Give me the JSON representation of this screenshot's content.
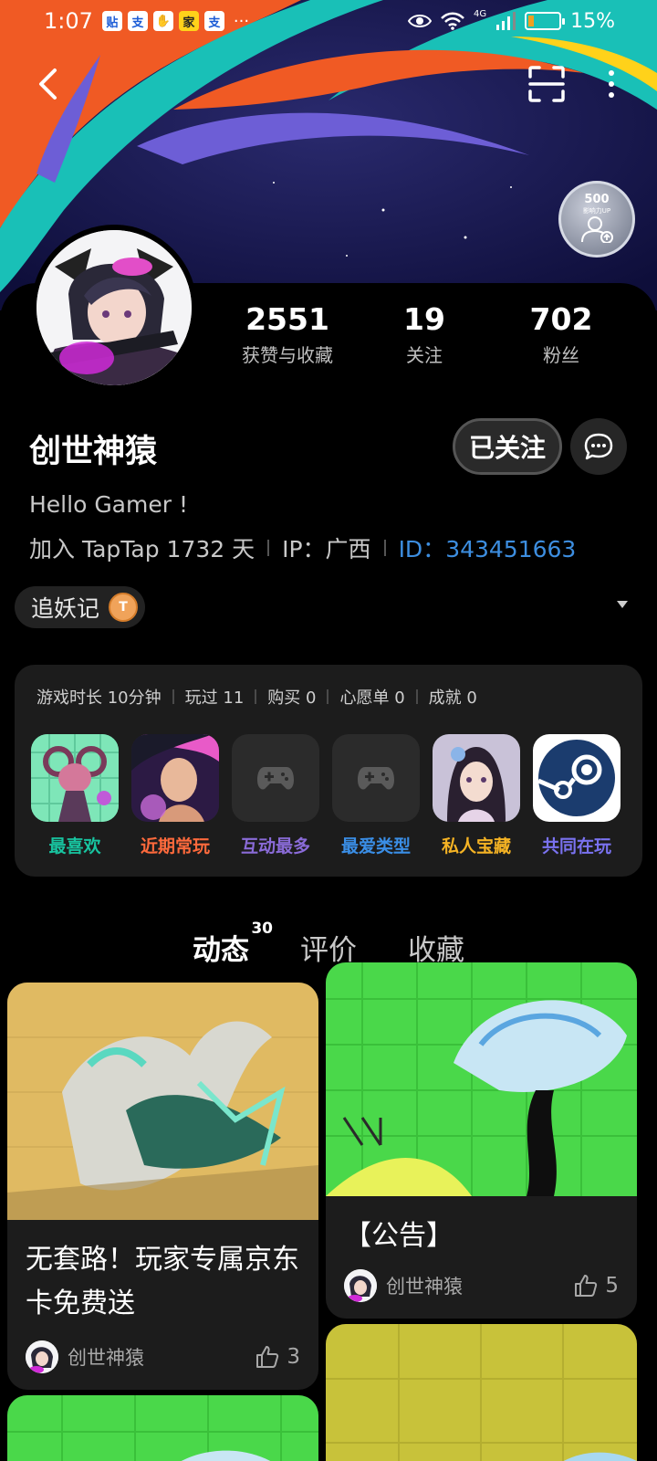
{
  "status_bar": {
    "time": "1:07",
    "app_icons": [
      "贴",
      "支",
      "✋",
      "家",
      "支"
    ],
    "more": "···",
    "network": "4G",
    "battery": "15%"
  },
  "profile": {
    "stats": [
      {
        "value": "2551",
        "label": "获赞与收藏"
      },
      {
        "value": "19",
        "label": "关注"
      },
      {
        "value": "702",
        "label": "粉丝"
      }
    ],
    "badge": {
      "value": "500",
      "caption": "影响力UP"
    },
    "username": "创世神猿",
    "follow_label": "已关注",
    "bio": "Hello Gamer !",
    "joined": "加入 TapTap 1732 天",
    "ip": "IP：广西",
    "id_label": "ID：",
    "id_value": "343451663",
    "tag": "追妖记",
    "tag_medal": "T"
  },
  "game_card": {
    "stats": [
      "游戏时长 10分钟",
      "玩过 11",
      "购买 0",
      "心愿单 0",
      "成就 0"
    ],
    "tiles": [
      {
        "label": "最喜欢",
        "color": "#18c4a0"
      },
      {
        "label": "近期常玩",
        "color": "#ff6a3c"
      },
      {
        "label": "互动最多",
        "color": "#8a6bd8"
      },
      {
        "label": "最爱类型",
        "color": "#3a8ee6"
      },
      {
        "label": "私人宝藏",
        "color": "#f5b324"
      },
      {
        "label": "共同在玩",
        "color": "#7a72f0"
      }
    ]
  },
  "tabs": {
    "items": [
      {
        "label": "动态",
        "count": "30"
      },
      {
        "label": "评价"
      },
      {
        "label": "收藏"
      }
    ]
  },
  "feed": {
    "posts": [
      {
        "title": "无套路！玩家专属京东卡免费送",
        "author": "创世神猿",
        "likes": "3"
      },
      {
        "title": "【公告】",
        "author": "创世神猿",
        "likes": "5"
      }
    ]
  },
  "colors": {
    "accent": "#15c5ce",
    "link": "#3d8ee0"
  }
}
